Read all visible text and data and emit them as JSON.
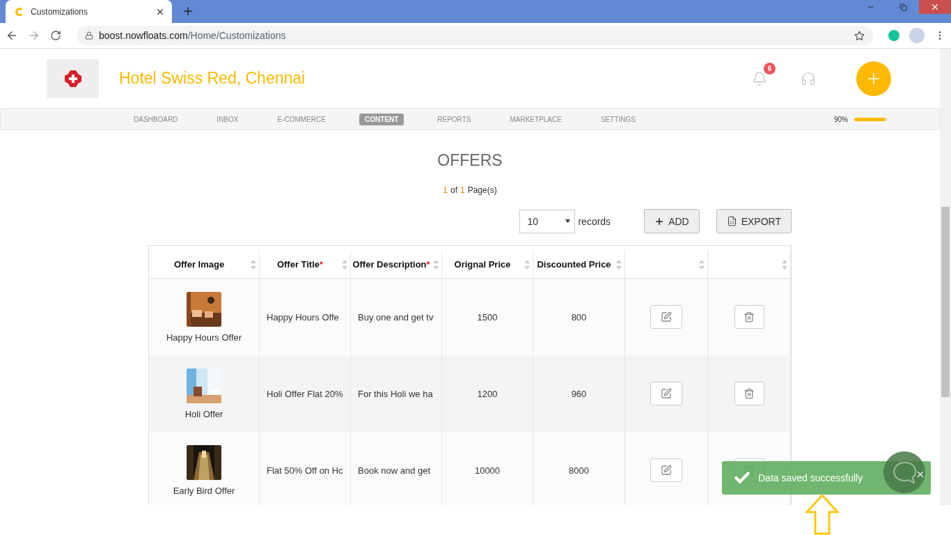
{
  "browser": {
    "tab_title": "Customizations",
    "url_host": "boost.nowfloats.com",
    "url_path": "/Home/Customizations"
  },
  "header": {
    "business_name": "Hotel Swiss Red, Chennai",
    "notification_count": "6"
  },
  "nav": {
    "items": [
      {
        "label": "DASHBOARD",
        "selected": false
      },
      {
        "label": "INBOX",
        "selected": false
      },
      {
        "label": "E-COMMERCE",
        "selected": false
      },
      {
        "label": "CONTENT",
        "selected": true
      },
      {
        "label": "REPORTS",
        "selected": false
      },
      {
        "label": "MARKETPLACE",
        "selected": false
      },
      {
        "label": "SETTINGS",
        "selected": false
      }
    ],
    "progress": {
      "reading": "90%",
      "level": 0.9
    }
  },
  "title": "OFFERS",
  "pager": {
    "current": "1",
    "middle": "of",
    "total": "1",
    "suffix": "Page(s)"
  },
  "controls": {
    "page_size": "10",
    "records_label": "records",
    "buttons": [
      {
        "label": "ADD",
        "kind": "add"
      },
      {
        "label": "EXPORT",
        "kind": "export"
      }
    ]
  },
  "table": {
    "columns": [
      {
        "kind": "text",
        "label": "Offer Image"
      },
      {
        "kind": "text",
        "label": "Offer Title",
        "required_mark": "*"
      },
      {
        "kind": "text",
        "label": "Offer Description",
        "required_mark": "*"
      },
      {
        "kind": "text",
        "label": "Orignal Price"
      },
      {
        "kind": "text",
        "label": "Discounted Price"
      },
      {
        "kind": "action"
      },
      {
        "kind": "action"
      }
    ],
    "rows": [
      {
        "image_caption": "Happy Hours Offer",
        "title": "Happy Hours Offe",
        "description": "Buy one and get tv",
        "original_price": "1500",
        "discounted_price": "800"
      },
      {
        "image_caption": "Holi Offer",
        "title": "Holi Offer Flat 20%",
        "description": "For this Holi we ha",
        "original_price": "1200",
        "discounted_price": "960"
      },
      {
        "image_caption": "Early Bird Offer",
        "title": "Flat 50% Off on Hc",
        "description": "Book now and get",
        "original_price": "10000",
        "discounted_price": "8000"
      }
    ]
  },
  "toast": {
    "message": "Data saved successfully"
  }
}
